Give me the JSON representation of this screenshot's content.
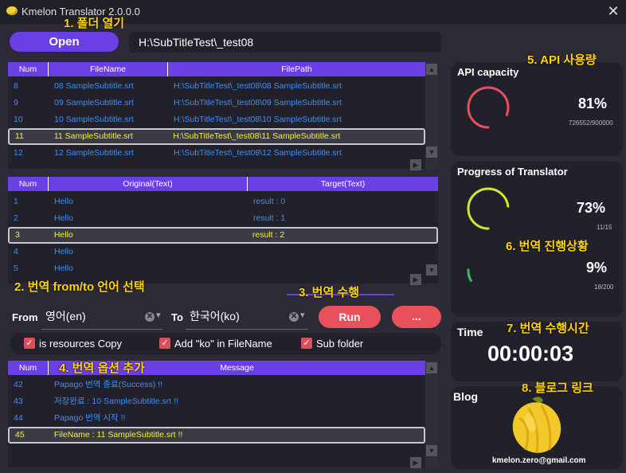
{
  "window": {
    "title": "Kmelon Translator 2.0.0.0",
    "close_glyph": "✕"
  },
  "open_button": "Open",
  "folder_path": "H:\\SubTitleTest\\_test08",
  "annotations": {
    "a1": "1. 폴더 열기",
    "a2": "2. 번역 from/to 언어 선택",
    "a3": "3. 번역 수행",
    "a4": "4. 번역 옵션 추가",
    "a5": "5. API 사용량",
    "a6": "6. 번역 진행상황",
    "a7": "7. 번역 수행시간",
    "a8": "8. 블로그 링크"
  },
  "files_table": {
    "headers": [
      "Num",
      "FileName",
      "FilePath"
    ],
    "rows": [
      [
        "8",
        "08 SampleSubtitle.srt",
        "H:\\SubTitleTest\\_test08\\08 SampleSubtitle.srt"
      ],
      [
        "9",
        "09 SampleSubtitle.srt",
        "H:\\SubTitleTest\\_test08\\09 SampleSubtitle.srt"
      ],
      [
        "10",
        "10 SampleSubtitle.srt",
        "H:\\SubTitleTest\\_test08\\10 SampleSubtitle.srt"
      ],
      [
        "11",
        "11 SampleSubtitle.srt",
        "H:\\SubTitleTest\\_test08\\11 SampleSubtitle.srt"
      ],
      [
        "12",
        "12 SampleSubtitle.srt",
        "H:\\SubTitleTest\\_test08\\12 SampleSubtitle.srt"
      ]
    ],
    "selected_index": 3
  },
  "text_table": {
    "headers": [
      "Num",
      "Original(Text)",
      "Target(Text)"
    ],
    "rows": [
      [
        "1",
        "Hello",
        "result : 0"
      ],
      [
        "2",
        "Hello",
        "result : 1"
      ],
      [
        "3",
        "Hello",
        "result : 2"
      ],
      [
        "4",
        "Hello",
        ""
      ],
      [
        "5",
        "Hello",
        ""
      ]
    ],
    "selected_index": 2
  },
  "lang": {
    "from_label": "From",
    "from_value": "영어(en)",
    "to_label": "To",
    "to_value": "한국어(ko)",
    "clear_glyph": "✕",
    "dropdown_glyph": "▾"
  },
  "run_button": "Run",
  "more_button": "...",
  "options": [
    {
      "label": "is resources Copy",
      "checked": true
    },
    {
      "label": "Add \"ko\" in FileName",
      "checked": true
    },
    {
      "label": "Sub folder",
      "checked": true
    }
  ],
  "check_glyph": "✓",
  "message_table": {
    "headers": [
      "Num",
      "Message"
    ],
    "rows": [
      [
        "42",
        "Papago 번역 종료(Success) !!"
      ],
      [
        "43",
        "저장완료 : 10 SampleSubtitle.srt !!"
      ],
      [
        "44",
        "Papago 번역 시작 !!"
      ],
      [
        "45",
        "FileName : 11 SampleSubtitle.srt !!"
      ]
    ],
    "selected_index": 3
  },
  "scroll": {
    "up": "▲",
    "down": "▼",
    "left": "◀",
    "right": "▶"
  },
  "api_capacity": {
    "title": "API capacity",
    "percent_text": "81%",
    "detail": "726552/900000",
    "percent": 0.81,
    "color": "#e8505b"
  },
  "progress": {
    "title": "Progress of Translator",
    "file_percent_text": "73%",
    "file_detail": "11/15",
    "file_percent": 0.73,
    "file_color": "#d6e82a",
    "line_percent_text": "9%",
    "line_detail": "18/200",
    "line_percent": 0.09,
    "line_color": "#2fc35a"
  },
  "time": {
    "title": "Time",
    "value": "00:00:03"
  },
  "blog": {
    "title": "Blog",
    "email": "kmelon.zero@gmail.com"
  }
}
